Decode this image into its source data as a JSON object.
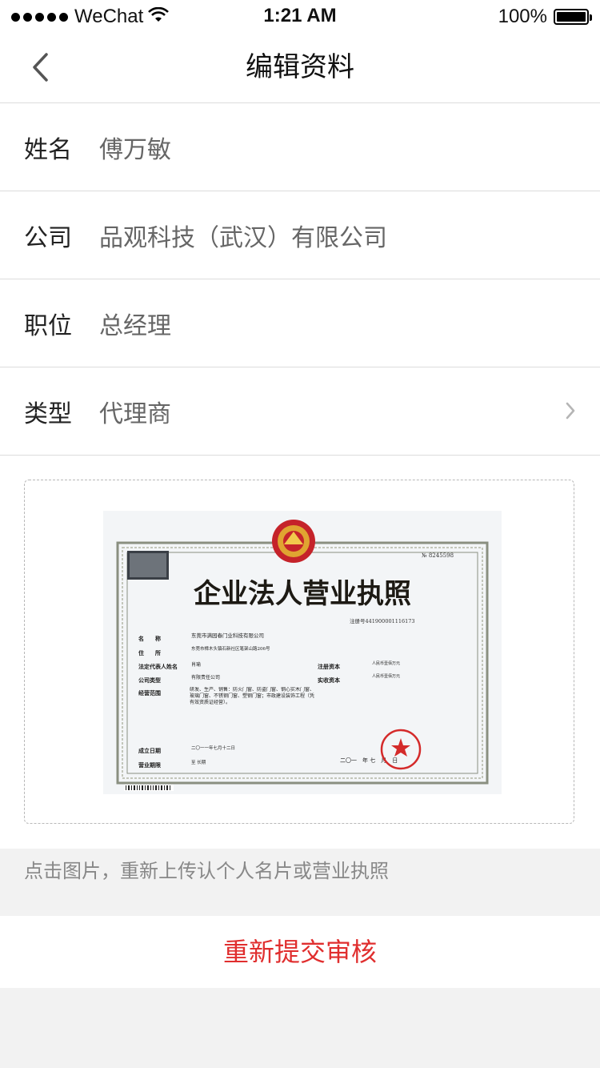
{
  "status_bar": {
    "carrier": "WeChat",
    "time": "1:21 AM",
    "battery": "100%"
  },
  "nav": {
    "title": "编辑资料"
  },
  "form": {
    "rows": [
      {
        "label": "姓名",
        "value": "傅万敏"
      },
      {
        "label": "公司",
        "value": "品观科技（武汉）有限公司"
      },
      {
        "label": "职位",
        "value": "总经理"
      },
      {
        "label": "类型",
        "value": "代理商"
      }
    ]
  },
  "license": {
    "title": "企业法人营业执照",
    "serial": "№ 8245598",
    "reg_no": "注册号441900001116173",
    "fields": [
      {
        "label": "名　　称",
        "value": "东莞市满园春门业科技有限公司"
      },
      {
        "label": "住　　所",
        "value": "东莞市樟木头镇石新社区笔架山路206号"
      },
      {
        "label": "法定代表人姓名",
        "value": "肖瑜"
      },
      {
        "label": "公司类型",
        "value": "有限责任公司"
      },
      {
        "label": "经营范围",
        "value": "研发、生产、销售：防火门窗、防盗门窗、钢心实木门窗、玻璃门窗、不锈钢门窗、塑钢门窗；市政建设装饰工程（凭有效资质证经营）。"
      },
      {
        "label": "成立日期",
        "value": "二〇一一年七月十二日"
      },
      {
        "label": "营业期限",
        "value": "至 长期"
      }
    ],
    "reg_capital_label": "注册资本",
    "reg_capital_value": "人民币壹佰万元",
    "paid_capital_label": "实收资本",
    "paid_capital_value": "人民币壹佰万元",
    "issue_date": "二〇一　年 七　月　日"
  },
  "hint": "点击图片，重新上传认个人名片或营业执照",
  "submit_label": "重新提交审核",
  "colors": {
    "accent": "#e02e2e",
    "divider": "#dcdcdc",
    "background": "#f2f2f2"
  }
}
